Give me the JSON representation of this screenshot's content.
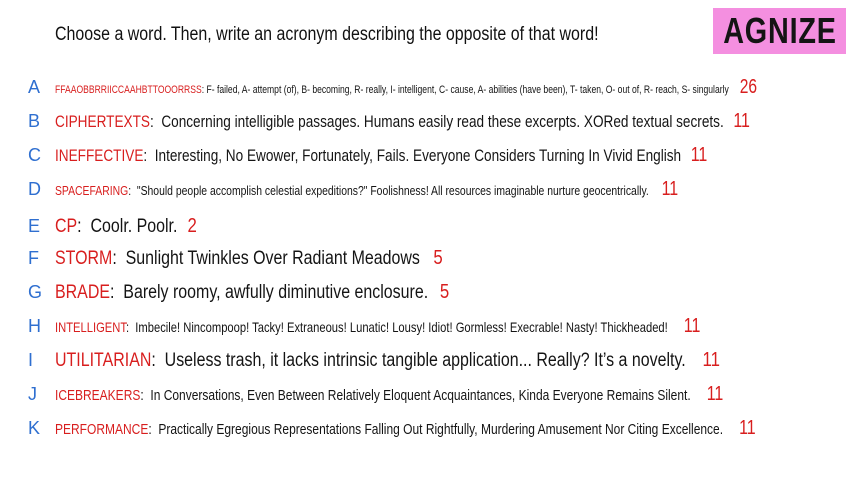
{
  "prompt": "Choose a word. Then, write an acronym describing the opposite of that word!",
  "logo": "AGNIZE",
  "entries": [
    {
      "letter": "A",
      "word": "FFAAOBBRRIICCAAHBTTOOORRSS",
      "definition": "F- failed, A- attempt (of), B- becoming, R- really, I- intelligent, C- cause, A- abilities (have been), T- taken, O- out of, R- reach, S- singularly",
      "score": "26"
    },
    {
      "letter": "B",
      "word": "CIPHERTEXTS",
      "definition": "Concerning intelligible passages. Humans easily read these excerpts. XORed textual secrets.",
      "score": "11"
    },
    {
      "letter": "C",
      "word": "INEFFECTIVE",
      "definition": "Interesting, No Ewower, Fortunately, Fails. Everyone Considers Turning In Vivid English",
      "score": "11"
    },
    {
      "letter": "D",
      "word": "SPACEFARING",
      "definition": "\"Should people accomplish celestial expeditions?\" Foolishness! All resources imaginable nurture geocentrically.",
      "score": "11"
    },
    {
      "letter": "E",
      "word": "CP",
      "definition": "Coolr. Poolr.",
      "score": "2"
    },
    {
      "letter": "F",
      "word": "STORM",
      "definition": "Sunlight Twinkles Over Radiant Meadows",
      "score": "5"
    },
    {
      "letter": "G",
      "word": "BRADE",
      "definition": "Barely roomy, awfully diminutive enclosure.",
      "score": "5"
    },
    {
      "letter": "H",
      "word": "INTELLIGENT",
      "definition": "Imbecile! Nincompoop! Tacky! Extraneous! Lunatic! Lousy! Idiot! Gormless! Execrable! Nasty! Thickheaded!",
      "score": "11"
    },
    {
      "letter": "I",
      "word": "UTILITARIAN",
      "definition": "Useless trash, it lacks intrinsic tangible application... Really? It’s a novelty.",
      "score": "11"
    },
    {
      "letter": "J",
      "word": "ICEBREAKERS",
      "definition": "In Conversations, Even Between Relatively Eloquent Acquaintances, Kinda Everyone Remains Silent.",
      "score": "11"
    },
    {
      "letter": "K",
      "word": "PERFORMANCE",
      "definition": "Practically Egregious Representations Falling Out Rightfully, Murdering Amusement Nor Citing Excellence.",
      "score": "11"
    }
  ]
}
